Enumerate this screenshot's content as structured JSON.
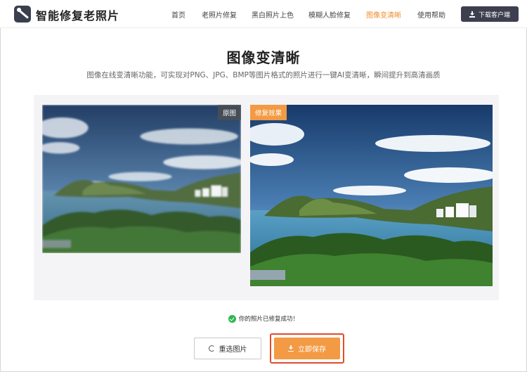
{
  "header": {
    "brand": "智能修复老照片",
    "nav": [
      {
        "label": "首页",
        "active": false
      },
      {
        "label": "老照片修复",
        "active": false
      },
      {
        "label": "黑白照片上色",
        "active": false
      },
      {
        "label": "模糊人脸修复",
        "active": false
      },
      {
        "label": "图像变清晰",
        "active": true
      },
      {
        "label": "使用帮助",
        "active": false
      }
    ],
    "download_label": "下载客户端"
  },
  "main": {
    "title": "图像变清晰",
    "subtitle": "图像在线变清晰功能，可实现对PNG、JPG、BMP等图片格式的照片进行一键AI变清晰，瞬间提升到高清画质"
  },
  "compare": {
    "original_tag": "原图",
    "fixed_tag": "修复效果"
  },
  "status": {
    "success_text": "你的照片已修复成功！"
  },
  "actions": {
    "reselect_label": "重选图片",
    "save_label": "立即保存"
  },
  "colors": {
    "accent": "#f39a44",
    "active_nav": "#f28b2c",
    "success": "#2db84d",
    "highlight_outline": "#e04b2d",
    "dark_button": "#3d3f4f"
  }
}
